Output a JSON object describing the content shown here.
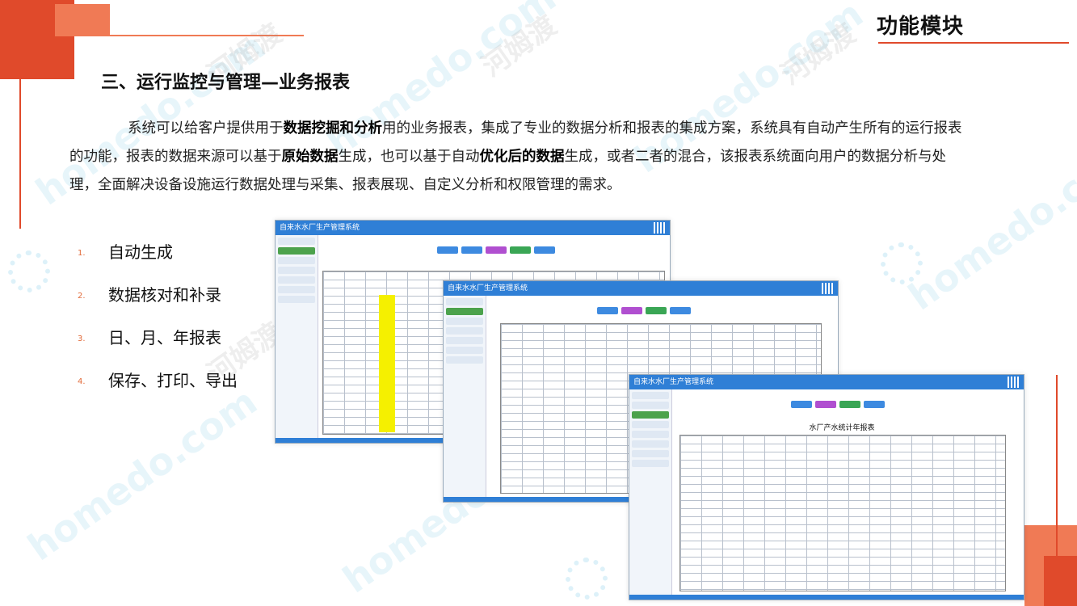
{
  "header": {
    "corner_title": "功能模块",
    "section_title": "三、运行监控与管理—业务报表"
  },
  "body": {
    "p1": "系统可以给客户提供用于",
    "b1": "数据挖掘和分析",
    "p2": "用的业务报表，集成了专业的数据分析和报表的集成方案，系统具有自动产生所有的运行报表的功能，报表的数据来源可以基于",
    "b2": "原始数据",
    "p3": "生成，也可以基于自动",
    "b3": "优化后的数据",
    "p4": "生成，或者二者的混合，该报表系统面向用户的数据分析与处理，全面解决设备设施运行数据处理与采集、报表展现、自定义分析和权限管理的需求。"
  },
  "list": [
    {
      "num": "1.",
      "label": "自动生成"
    },
    {
      "num": "2.",
      "label": "数据核对和补录"
    },
    {
      "num": "3.",
      "label": "日、月、年报表"
    },
    {
      "num": "4.",
      "label": "保存、打印、导出"
    }
  ],
  "screenshots": [
    {
      "title": "自来水水厂生产管理系统"
    },
    {
      "title": "自来水水厂生产管理系统"
    },
    {
      "title": "自来水水厂生产管理系统",
      "table_title": "水厂产水统计年报表"
    }
  ],
  "watermark": {
    "en": "homedo.com",
    "cn": "河姆渡"
  },
  "colors": {
    "accent": "#e04a2b",
    "accent_light": "#f07a55",
    "bar": "#2f7fd6"
  }
}
